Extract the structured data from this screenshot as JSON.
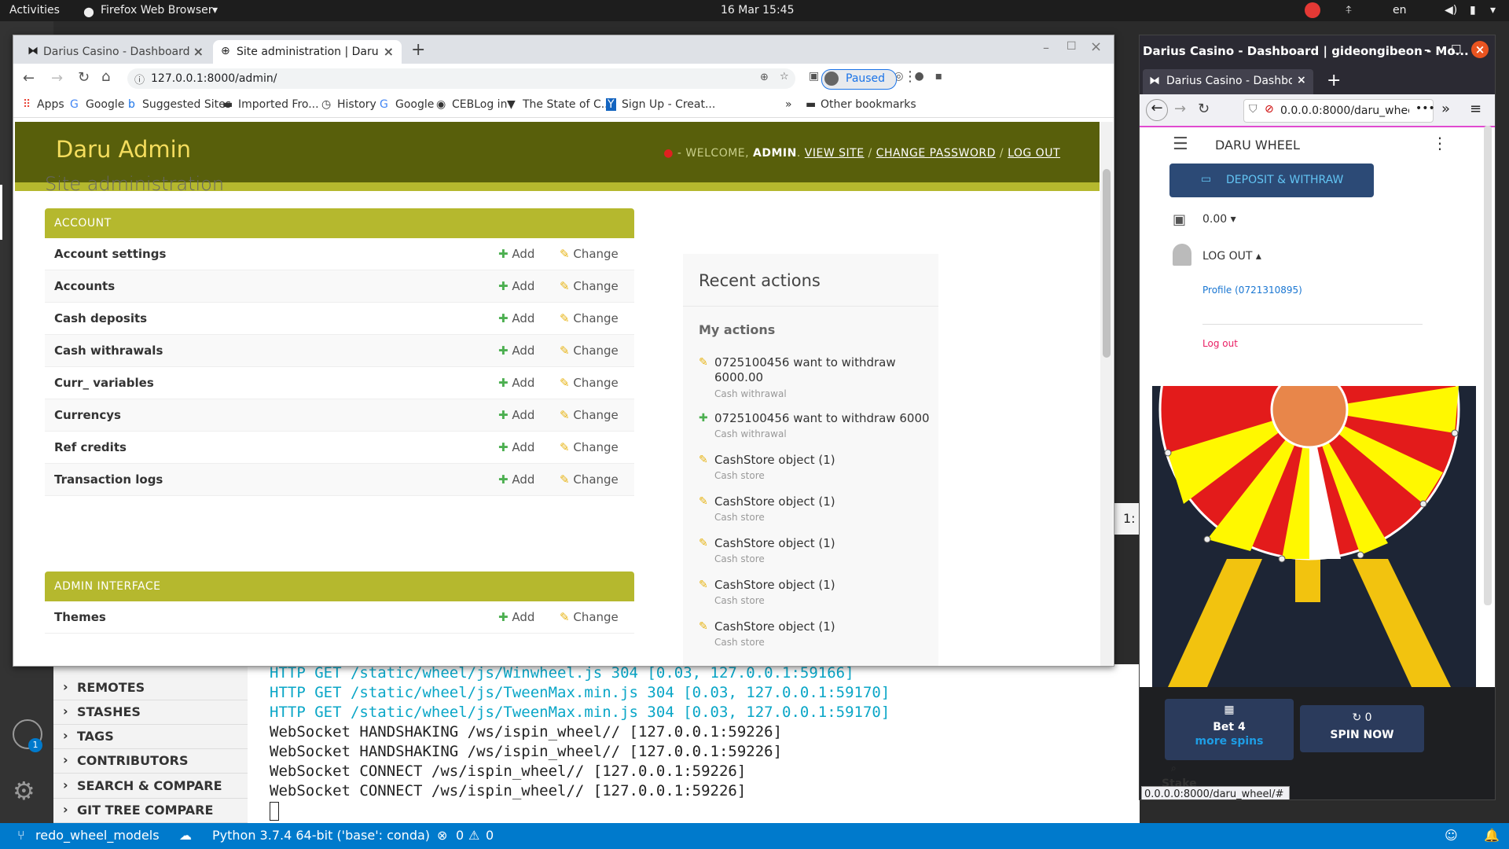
{
  "topbar": {
    "activities": "Activities",
    "app": "Firefox Web Browser",
    "clock": "16 Mar  15:45",
    "lang": "en"
  },
  "chrome": {
    "tabs": [
      {
        "label": "Darius Casino - Dashboard"
      },
      {
        "label": "Site administration | Daru"
      }
    ],
    "new_tab": "+",
    "url": "127.0.0.1:8000/admin/",
    "profile_status": "Paused",
    "bookmarks": [
      "Apps",
      "Google",
      "Suggested Sites",
      "Imported Fro...",
      "History",
      "Google",
      "CEBLog in",
      "The State of C...",
      "Sign Up - Creat..."
    ],
    "other_bookmarks": "Other bookmarks",
    "more": "»"
  },
  "admin": {
    "brand": "Daru Admin",
    "welcome": "- WELCOME,",
    "user": "ADMIN",
    "view_site": "VIEW SITE",
    "change_password": "CHANGE PASSWORD",
    "log_out": "LOG OUT",
    "title": "Site administration",
    "add": "Add",
    "change": "Change",
    "modules": [
      {
        "caption": "ACCOUNT",
        "models": [
          "Account settings",
          "Accounts",
          "Cash deposits",
          "Cash withrawals",
          "Curr_ variables",
          "Currencys",
          "Ref credits",
          "Transaction logs"
        ]
      },
      {
        "caption": "ADMIN INTERFACE",
        "models": [
          "Themes"
        ]
      }
    ],
    "recent": {
      "title": "Recent actions",
      "my_actions": "My actions",
      "items": [
        {
          "text": "0725100456 want to withdraw 6000.00",
          "type": "Cash withrawal",
          "icon": "pencil"
        },
        {
          "text": "0725100456 want to withdraw 6000",
          "type": "Cash withrawal",
          "icon": "plus"
        },
        {
          "text": "CashStore object (1)",
          "type": "Cash store",
          "icon": "pencil"
        },
        {
          "text": "CashStore object (1)",
          "type": "Cash store",
          "icon": "pencil"
        },
        {
          "text": "CashStore object (1)",
          "type": "Cash store",
          "icon": "pencil"
        },
        {
          "text": "CashStore object (1)",
          "type": "Cash store",
          "icon": "pencil"
        },
        {
          "text": "CashStore object (1)",
          "type": "Cash store",
          "icon": "pencil"
        }
      ]
    }
  },
  "firefox": {
    "title": "Darius Casino - Dashboard | gideongibeon - Mo...",
    "tab": "Darius Casino - Dashboar",
    "url": "0.0.0.0:8000/daru_wheel",
    "app_name": "DARU WHEEL",
    "deposit": "DEPOSIT & WITHRAW",
    "balance": "0.00",
    "logout_menu": "LOG OUT",
    "profile": "Profile (0721310895)",
    "logout": "Log out",
    "bet_label": "Bet 4",
    "bet_sub": "more spins",
    "spin_count": "0",
    "spin": "SPIN NOW",
    "stake": "Stake",
    "status_url": "0.0.0.0:8000/daru_wheel/#",
    "side_text": "1:"
  },
  "vscode": {
    "sections": [
      "REMOTES",
      "STASHES",
      "TAGS",
      "CONTRIBUTORS",
      "SEARCH & COMPARE",
      "GIT TREE COMPARE"
    ],
    "terminal": [
      "HTTP GET /static/wheel/js/Winwheel.js 304 [0.03, 127.0.0.1:59166]",
      "HTTP GET /static/wheel/js/TweenMax.min.js 304 [0.03, 127.0.0.1:59170]",
      "HTTP GET /static/wheel/js/TweenMax.min.js 304 [0.03, 127.0.0.1:59170]",
      "WebSocket HANDSHAKING /ws/ispin_wheel// [127.0.0.1:59226]",
      "WebSocket HANDSHAKING /ws/ispin_wheel// [127.0.0.1:59226]",
      "WebSocket CONNECT /ws/ispin_wheel// [127.0.0.1:59226]",
      "WebSocket CONNECT /ws/ispin_wheel// [127.0.0.1:59226]"
    ],
    "badge": "1",
    "branch": "redo_wheel_models",
    "python": "Python 3.7.4 64-bit ('base': conda)",
    "errors": "0",
    "warnings": "0"
  }
}
